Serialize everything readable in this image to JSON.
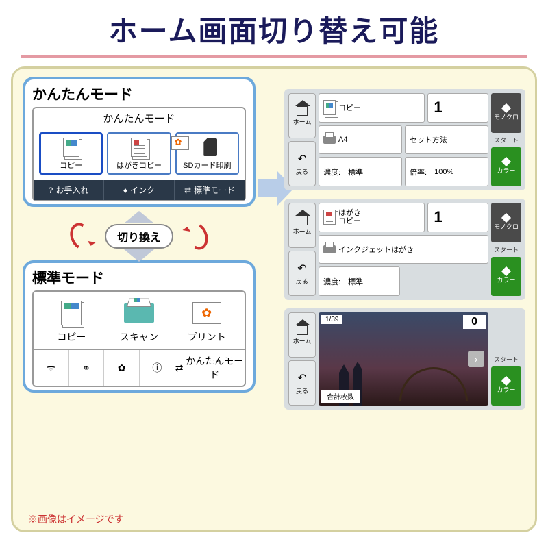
{
  "title": "ホーム画面切り替え可能",
  "footnote": "※画像はイメージです",
  "switch_label": "切り換え",
  "simple_mode": {
    "title": "かんたんモード",
    "screen_title": "かんたんモード",
    "buttons": {
      "copy": "コピー",
      "hagaki": "はがきコピー",
      "sd": "SDカード印刷"
    },
    "bottom": {
      "maint": "お手入れ",
      "ink": "インク",
      "switch": "標準モード"
    }
  },
  "standard_mode": {
    "title": "標準モード",
    "buttons": {
      "copy": "コピー",
      "scan": "スキャン",
      "print": "プリント"
    },
    "bottom": {
      "switch": "かんたんモード"
    }
  },
  "panel_copy": {
    "side": {
      "home": "ホーム",
      "back": "戻る"
    },
    "header": "コピー",
    "count": "1",
    "paper": "A4",
    "set": "セット方法",
    "density_label": "濃度:",
    "density": "標準",
    "ratio_label": "倍率:",
    "ratio": "100%",
    "mono": "モノクロ",
    "start": "スタート",
    "color": "カラー"
  },
  "panel_hagaki": {
    "side": {
      "home": "ホーム",
      "back": "戻る"
    },
    "header_l1": "はがき",
    "header_l2": "コピー",
    "count": "1",
    "media": "インクジェットはがき",
    "density_label": "濃度:",
    "density": "標準",
    "mono": "モノクロ",
    "start": "スタート",
    "color": "カラー"
  },
  "panel_photo": {
    "side": {
      "home": "ホーム",
      "back": "戻る"
    },
    "pager": "1/39",
    "count": "0",
    "total_label": "合計枚数",
    "start": "スタート",
    "color": "カラー"
  }
}
